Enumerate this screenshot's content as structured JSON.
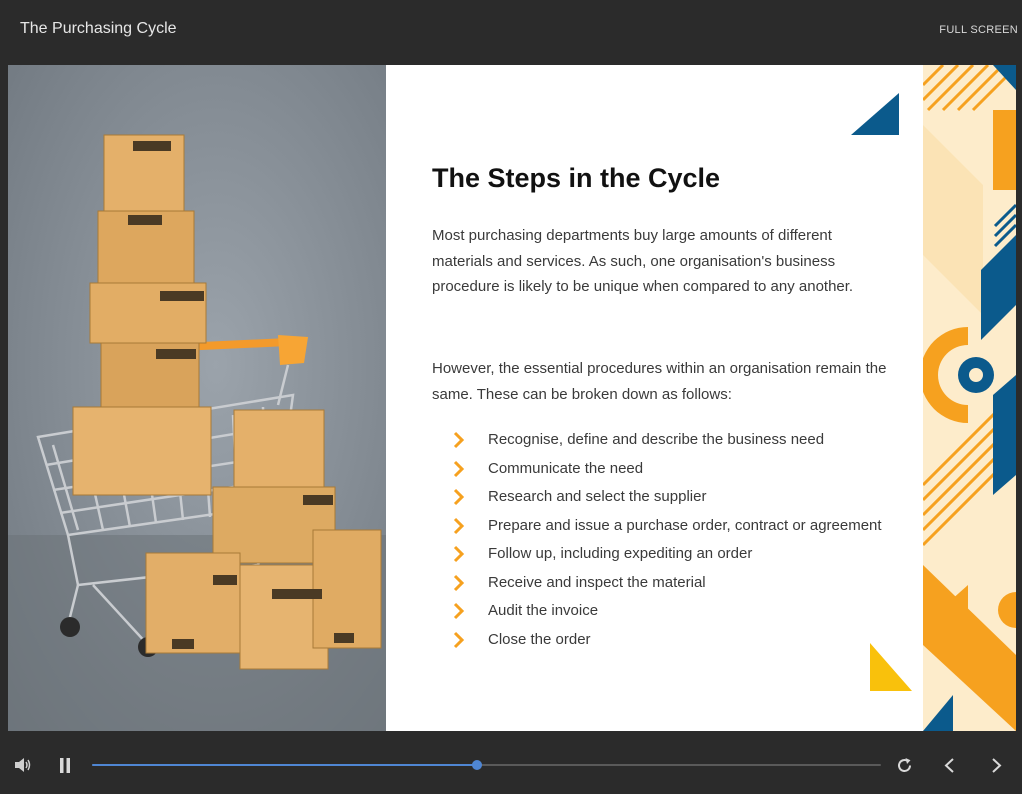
{
  "app": {
    "title": "The Purchasing Cycle",
    "fullscreen_label": "FULL SCREEN"
  },
  "slide": {
    "heading": "The Steps in the Cycle",
    "paragraph_1": "Most purchasing departments buy large amounts of different materials and services. As such, one organisation's business procedure is likely to be unique when compared to any another.",
    "paragraph_2": "However, the essential procedures within an organisation remain the same. These can be broken down as follows:",
    "steps": [
      "Recognise, define and describe the business need",
      "Communicate the need",
      "Research and select the supplier",
      "Prepare and issue a purchase order, contract or agreement",
      "Follow up, including expediting an order",
      "Receive and inspect the material",
      "Audit the invoice",
      "Close the order"
    ],
    "image": "shopping-cart-with-cardboard-boxes"
  },
  "player": {
    "progress_fraction": 0.488,
    "state": "playing"
  },
  "colors": {
    "accent_orange": "#f6a11f",
    "accent_blue": "#0b5a8c",
    "accent_yellow": "#f9c10c",
    "progress_blue": "#4f86d3"
  },
  "icons": [
    "volume-icon",
    "pause-icon",
    "replay-icon",
    "previous-icon",
    "next-icon",
    "chevron-right-icon"
  ]
}
